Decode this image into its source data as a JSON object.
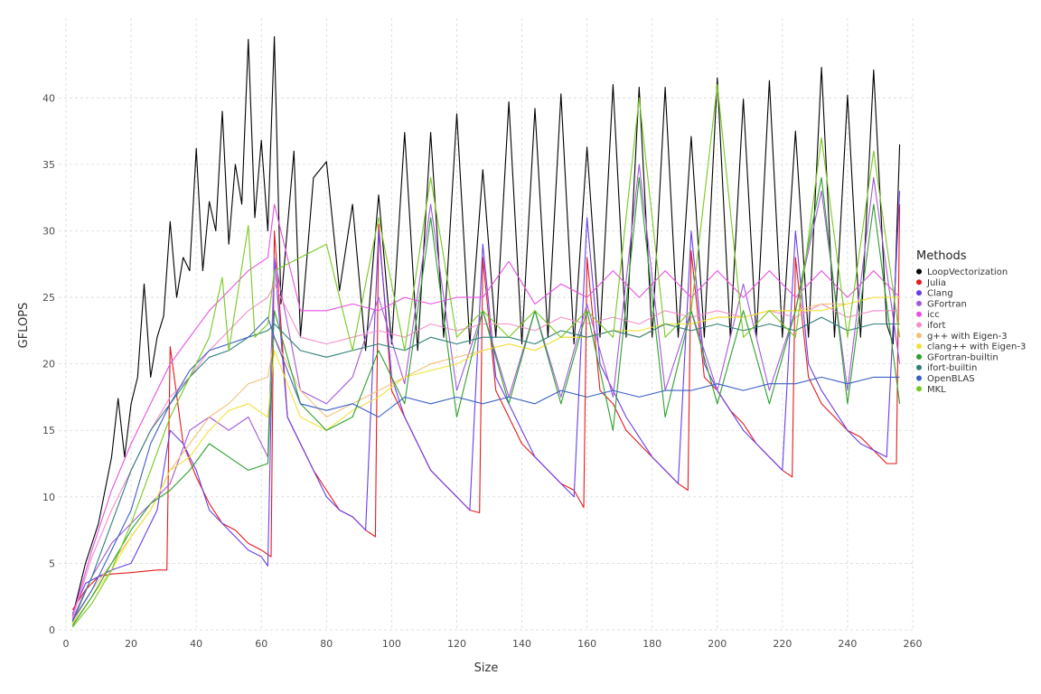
{
  "chart_data": {
    "type": "line",
    "title": "",
    "xlabel": "Size",
    "ylabel": "GFLOPS",
    "xlim": [
      0,
      260
    ],
    "ylim": [
      0,
      46
    ],
    "x_ticks": [
      0,
      20,
      40,
      60,
      80,
      100,
      120,
      140,
      160,
      180,
      200,
      220,
      240,
      260
    ],
    "y_ticks": [
      0,
      5,
      10,
      15,
      20,
      25,
      30,
      35,
      40
    ],
    "grid": true,
    "legend": {
      "title": "Methods",
      "position": "right"
    },
    "series": [
      {
        "name": "LoopVectorization",
        "color": "#000000",
        "x": [
          2,
          6,
          10,
          14,
          16,
          18,
          20,
          22,
          24,
          26,
          28,
          30,
          32,
          34,
          36,
          38,
          40,
          42,
          44,
          46,
          48,
          50,
          52,
          54,
          56,
          58,
          60,
          62,
          64,
          66,
          70,
          72,
          76,
          80,
          84,
          88,
          92,
          96,
          100,
          104,
          108,
          112,
          116,
          120,
          124,
          128,
          132,
          136,
          140,
          144,
          148,
          152,
          156,
          160,
          164,
          168,
          172,
          176,
          180,
          184,
          188,
          192,
          196,
          200,
          204,
          208,
          212,
          216,
          220,
          224,
          228,
          232,
          236,
          240,
          244,
          248,
          252,
          254,
          256
        ],
        "y": [
          1.0,
          5.0,
          8.0,
          13.0,
          17.4,
          13.0,
          17.0,
          19.0,
          26.0,
          19.0,
          22.0,
          23.6,
          30.7,
          25.0,
          28.0,
          27.0,
          36.2,
          27.0,
          32.2,
          30.0,
          39.0,
          29.0,
          35.0,
          32.0,
          44.4,
          31.0,
          36.8,
          30.0,
          44.6,
          24.5,
          36.0,
          22.0,
          34.0,
          35.2,
          25.5,
          32.0,
          21.0,
          32.7,
          21.5,
          37.4,
          21.0,
          37.4,
          22.0,
          38.8,
          21.5,
          34.6,
          22.0,
          39.7,
          21.5,
          39.2,
          22.0,
          40.3,
          21.5,
          36.3,
          22.0,
          41.0,
          22.0,
          40.8,
          22.0,
          40.8,
          22.0,
          37.1,
          22.0,
          41.5,
          22.0,
          39.9,
          22.0,
          41.3,
          22.0,
          37.5,
          22.0,
          42.3,
          22.0,
          40.2,
          22.0,
          42.1,
          23.0,
          21.5,
          36.5
        ]
      },
      {
        "name": "Julia",
        "color": "#e41a1c",
        "x": [
          2,
          6,
          10,
          14,
          20,
          24,
          28,
          31,
          32,
          36,
          40,
          44,
          48,
          52,
          56,
          60,
          63,
          64,
          68,
          72,
          76,
          80,
          84,
          88,
          92,
          95,
          96,
          100,
          104,
          108,
          112,
          116,
          120,
          124,
          127,
          128,
          132,
          136,
          140,
          144,
          148,
          152,
          156,
          159,
          160,
          164,
          168,
          172,
          176,
          180,
          184,
          188,
          191,
          192,
          196,
          200,
          204,
          208,
          212,
          216,
          220,
          223,
          224,
          228,
          232,
          236,
          240,
          244,
          248,
          252,
          255,
          256
        ],
        "y": [
          1.5,
          3.0,
          4.0,
          4.2,
          4.3,
          4.4,
          4.5,
          4.5,
          21.3,
          14.0,
          11.5,
          9.5,
          8.0,
          7.5,
          6.5,
          6.0,
          5.5,
          30.0,
          16.0,
          14.0,
          12.0,
          10.5,
          9.0,
          8.5,
          7.5,
          7.0,
          30.5,
          18.0,
          16.0,
          14.0,
          12.0,
          11.0,
          10.0,
          9.0,
          8.8,
          28.0,
          18.0,
          16.0,
          14.0,
          13.0,
          12.0,
          11.0,
          10.5,
          9.2,
          28.0,
          18.0,
          17.0,
          15.0,
          14.0,
          13.0,
          12.0,
          11.0,
          10.5,
          28.5,
          19.0,
          18.0,
          16.5,
          15.5,
          14.0,
          13.0,
          12.0,
          11.5,
          28.0,
          19.0,
          17.0,
          16.0,
          15.0,
          14.5,
          13.5,
          12.5,
          12.5,
          32.0
        ]
      },
      {
        "name": "Clang",
        "color": "#6a3de8",
        "x": [
          2,
          6,
          10,
          14,
          20,
          24,
          28,
          32,
          36,
          40,
          44,
          48,
          52,
          56,
          60,
          62,
          64,
          68,
          72,
          76,
          80,
          84,
          88,
          92,
          96,
          100,
          104,
          108,
          112,
          116,
          120,
          124,
          128,
          132,
          136,
          140,
          144,
          148,
          152,
          156,
          160,
          164,
          168,
          172,
          176,
          180,
          184,
          188,
          192,
          196,
          200,
          204,
          208,
          212,
          216,
          220,
          224,
          228,
          232,
          236,
          240,
          244,
          248,
          252,
          256
        ],
        "y": [
          1.2,
          3.5,
          4.0,
          4.5,
          5.0,
          7.0,
          9.0,
          15.0,
          14.0,
          12.0,
          9.0,
          8.0,
          7.0,
          6.0,
          5.5,
          4.8,
          28.0,
          16.0,
          14.0,
          12.0,
          10.0,
          9.0,
          8.5,
          7.5,
          30.0,
          19.0,
          16.0,
          14.0,
          12.0,
          11.0,
          10.0,
          9.0,
          29.0,
          19.0,
          17.0,
          15.0,
          13.0,
          12.0,
          11.0,
          10.0,
          31.0,
          20.0,
          18.0,
          16.0,
          14.5,
          13.0,
          12.0,
          11.0,
          30.0,
          20.0,
          18.0,
          16.5,
          15.0,
          14.0,
          13.0,
          12.0,
          30.0,
          20.0,
          18.0,
          16.5,
          15.0,
          14.0,
          13.5,
          13.0,
          33.0
        ]
      },
      {
        "name": "GFortran",
        "color": "#a259d9",
        "x": [
          2,
          8,
          14,
          20,
          26,
          32,
          38,
          44,
          50,
          56,
          62,
          64,
          72,
          80,
          88,
          96,
          104,
          112,
          120,
          128,
          136,
          144,
          152,
          160,
          168,
          176,
          184,
          192,
          200,
          208,
          216,
          224,
          232,
          240,
          248,
          256
        ],
        "y": [
          0.8,
          4.0,
          6.5,
          8.0,
          9.5,
          11.0,
          15.0,
          16.0,
          15.0,
          16.0,
          13.0,
          28.0,
          18.0,
          17.0,
          19.0,
          25.0,
          18.5,
          32.0,
          18.0,
          24.0,
          17.5,
          24.0,
          17.5,
          24.5,
          17.5,
          35.0,
          18.0,
          24.0,
          18.0,
          26.0,
          18.0,
          24.0,
          33.0,
          18.0,
          34.0,
          20.0
        ]
      },
      {
        "name": "icc",
        "color": "#e94fe3",
        "x": [
          2,
          8,
          14,
          20,
          26,
          32,
          38,
          44,
          50,
          56,
          62,
          64,
          72,
          80,
          88,
          96,
          104,
          112,
          120,
          128,
          136,
          144,
          152,
          160,
          168,
          176,
          184,
          192,
          200,
          208,
          216,
          224,
          232,
          240,
          248,
          256
        ],
        "y": [
          1.0,
          6.0,
          10.5,
          14.0,
          17.0,
          20.0,
          22.0,
          24.0,
          25.5,
          27.0,
          28.0,
          32.0,
          24.0,
          24.0,
          24.5,
          24.0,
          25.0,
          24.5,
          25.0,
          25.0,
          27.7,
          24.5,
          26.0,
          25.0,
          27.0,
          25.0,
          27.0,
          25.0,
          27.0,
          25.0,
          27.0,
          25.0,
          27.0,
          25.0,
          27.0,
          25.0
        ]
      },
      {
        "name": "ifort",
        "color": "#f78ecb",
        "x": [
          2,
          8,
          14,
          20,
          26,
          32,
          38,
          44,
          50,
          56,
          62,
          64,
          72,
          80,
          88,
          96,
          104,
          112,
          120,
          128,
          136,
          144,
          152,
          160,
          168,
          176,
          184,
          192,
          200,
          208,
          216,
          224,
          232,
          240,
          248,
          256
        ],
        "y": [
          0.9,
          5.5,
          9.0,
          12.0,
          15.0,
          17.5,
          19.0,
          21.0,
          22.5,
          24.0,
          25.0,
          26.0,
          22.0,
          21.5,
          22.0,
          22.5,
          22.0,
          23.0,
          22.5,
          23.0,
          23.0,
          22.5,
          23.5,
          23.0,
          23.5,
          23.0,
          24.0,
          23.5,
          24.0,
          23.5,
          24.0,
          23.5,
          24.5,
          23.5,
          24.0,
          24.0
        ]
      },
      {
        "name": "g++ with Eigen-3",
        "color": "#f2c27a",
        "x": [
          2,
          8,
          14,
          20,
          26,
          32,
          38,
          44,
          50,
          56,
          62,
          64,
          72,
          80,
          88,
          96,
          104,
          112,
          120,
          128,
          136,
          144,
          152,
          160,
          168,
          176,
          184,
          192,
          200,
          208,
          216,
          224,
          232,
          240,
          248,
          256
        ],
        "y": [
          0.5,
          3.0,
          5.0,
          7.0,
          9.0,
          12.0,
          14.0,
          16.0,
          17.0,
          18.5,
          19.0,
          22.0,
          18.0,
          16.0,
          17.0,
          18.0,
          19.0,
          20.0,
          20.5,
          21.0,
          21.5,
          21.0,
          22.0,
          22.0,
          22.5,
          22.0,
          23.0,
          23.0,
          23.5,
          23.5,
          24.0,
          24.0,
          24.5,
          24.5,
          25.0,
          25.0
        ]
      },
      {
        "name": "clang++ with Eigen-3",
        "color": "#f2e13a",
        "x": [
          2,
          8,
          14,
          20,
          26,
          32,
          38,
          44,
          50,
          56,
          62,
          64,
          72,
          80,
          88,
          96,
          104,
          112,
          120,
          128,
          136,
          144,
          152,
          160,
          168,
          176,
          184,
          192,
          200,
          208,
          216,
          224,
          232,
          240,
          248,
          256
        ],
        "y": [
          0.4,
          2.5,
          4.5,
          7.0,
          9.0,
          12.0,
          13.0,
          15.0,
          16.5,
          17.0,
          16.0,
          21.0,
          16.0,
          15.0,
          16.5,
          17.5,
          19.0,
          19.5,
          20.0,
          21.0,
          21.5,
          21.0,
          22.0,
          22.0,
          22.5,
          22.5,
          23.0,
          23.0,
          23.5,
          23.5,
          24.0,
          24.0,
          24.0,
          24.5,
          25.0,
          25.0
        ]
      },
      {
        "name": "GFortran-builtin",
        "color": "#2ca02c",
        "x": [
          2,
          8,
          14,
          20,
          26,
          32,
          38,
          44,
          50,
          56,
          62,
          64,
          72,
          80,
          88,
          96,
          104,
          112,
          120,
          128,
          136,
          144,
          152,
          160,
          168,
          176,
          184,
          192,
          200,
          208,
          216,
          224,
          232,
          240,
          248,
          256
        ],
        "y": [
          0.3,
          2.5,
          5.0,
          7.5,
          9.5,
          10.5,
          12.0,
          14.0,
          13.0,
          12.0,
          12.5,
          24.0,
          17.0,
          15.0,
          16.0,
          21.0,
          17.0,
          31.0,
          16.0,
          24.0,
          17.0,
          24.0,
          17.0,
          24.0,
          15.0,
          34.0,
          16.0,
          24.0,
          17.0,
          24.0,
          17.0,
          24.0,
          34.0,
          17.0,
          32.0,
          17.0
        ]
      },
      {
        "name": "ifort-builtin",
        "color": "#2f7f7a",
        "x": [
          2,
          8,
          14,
          20,
          26,
          32,
          38,
          44,
          50,
          56,
          62,
          64,
          72,
          80,
          88,
          96,
          104,
          112,
          120,
          128,
          136,
          144,
          152,
          160,
          168,
          176,
          184,
          192,
          200,
          208,
          216,
          224,
          232,
          240,
          248,
          256
        ],
        "y": [
          0.6,
          4.0,
          8.0,
          12.0,
          15.0,
          17.0,
          19.0,
          20.5,
          21.0,
          22.0,
          22.5,
          23.0,
          21.0,
          20.5,
          21.0,
          21.5,
          21.0,
          22.0,
          21.5,
          22.0,
          22.0,
          21.5,
          22.5,
          22.0,
          22.5,
          22.0,
          23.0,
          22.5,
          23.0,
          22.5,
          23.0,
          22.5,
          23.5,
          22.5,
          23.0,
          23.0
        ]
      },
      {
        "name": "OpenBLAS",
        "color": "#3a5fc4",
        "x": [
          2,
          8,
          14,
          20,
          26,
          32,
          38,
          44,
          50,
          56,
          62,
          64,
          72,
          80,
          88,
          96,
          104,
          112,
          120,
          128,
          136,
          144,
          152,
          160,
          168,
          176,
          184,
          192,
          200,
          208,
          216,
          224,
          232,
          240,
          248,
          256
        ],
        "y": [
          0.7,
          3.0,
          6.0,
          9.0,
          14.0,
          17.0,
          19.5,
          21.0,
          21.5,
          22.0,
          23.5,
          22.0,
          17.0,
          16.5,
          17.0,
          16.0,
          17.5,
          17.0,
          17.5,
          17.0,
          17.5,
          17.0,
          18.0,
          17.5,
          18.0,
          17.5,
          18.0,
          18.0,
          18.5,
          18.0,
          18.5,
          18.5,
          19.0,
          18.5,
          19.0,
          19.0
        ]
      },
      {
        "name": "MKL",
        "color": "#77c91f",
        "x": [
          2,
          8,
          14,
          20,
          26,
          32,
          38,
          44,
          48,
          50,
          56,
          58,
          62,
          64,
          72,
          80,
          88,
          96,
          104,
          112,
          120,
          128,
          136,
          144,
          152,
          160,
          168,
          176,
          184,
          192,
          200,
          208,
          216,
          224,
          232,
          240,
          248,
          256
        ],
        "y": [
          0.2,
          2.0,
          4.5,
          8.0,
          12.0,
          16.0,
          19.0,
          22.0,
          26.5,
          21.0,
          30.4,
          22.0,
          23.0,
          27.0,
          28.0,
          29.0,
          21.0,
          31.0,
          21.0,
          34.0,
          22.0,
          24.0,
          22.0,
          24.0,
          22.0,
          24.0,
          22.0,
          40.0,
          22.0,
          24.0,
          41.0,
          22.0,
          24.0,
          22.0,
          37.0,
          22.0,
          36.0,
          22.0
        ]
      }
    ]
  }
}
